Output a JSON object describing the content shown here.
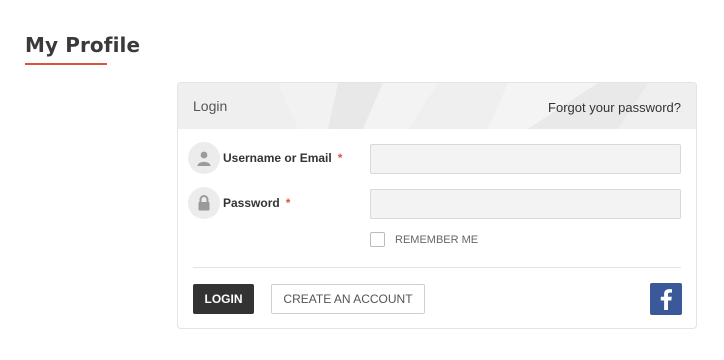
{
  "page": {
    "title": "My Profile",
    "accent_color": "#d9553f"
  },
  "login_card": {
    "header_title": "Login",
    "forgot_link": "Forgot your password?",
    "username": {
      "label": "Username or Email",
      "required_mark": "*",
      "value": "",
      "icon": "user-icon"
    },
    "password": {
      "label": "Password",
      "required_mark": "*",
      "value": "",
      "icon": "lock-icon"
    },
    "remember_me": {
      "label": "REMEMBER ME",
      "checked": false
    },
    "login_button": "LOGIN",
    "create_account_button": "CREATE AN ACCOUNT",
    "facebook_button": {
      "icon": "facebook-icon",
      "color": "#3b5998"
    }
  }
}
